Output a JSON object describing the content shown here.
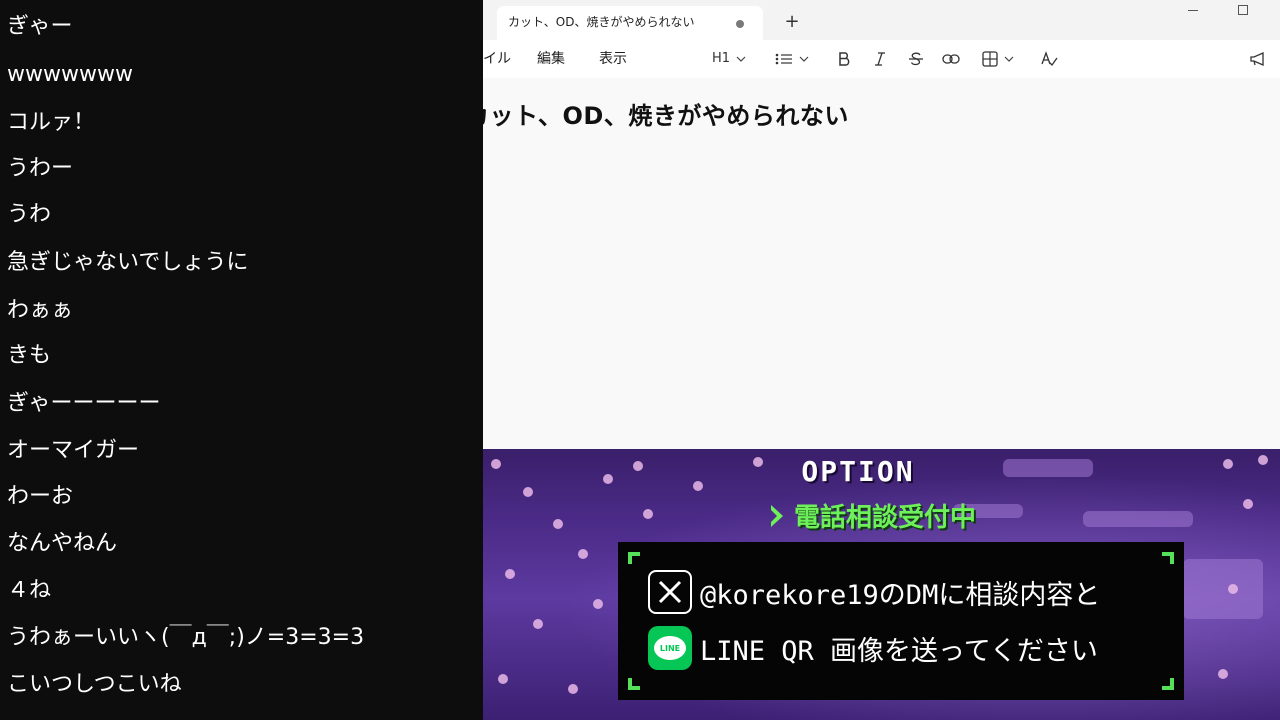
{
  "comments": [
    "ぎゃー",
    "wwwwwww",
    "コルァ！",
    "うわー",
    "うわ",
    "急ぎじゃないでしょうに",
    "わぁぁ",
    "きも",
    "ぎゃーーーーー",
    "オーマイガー",
    "わーお",
    "なんやねん",
    "４ね",
    "うわぁーいいヽ(￣д￣;)ノ=3=3=3",
    "こいつしつこいね"
  ],
  "notepad": {
    "tab_title": "カット、OD、焼きがやめられない",
    "new_tab_label": "+",
    "menu": {
      "file": "イル",
      "edit": "編集",
      "view": "表示"
    },
    "toolbar": {
      "heading_label": "H1",
      "icons": [
        "list-icon",
        "bold-icon",
        "italic-icon",
        "strikethrough-icon",
        "link-icon",
        "table-icon",
        "spellcheck-icon",
        "megaphone-icon"
      ]
    },
    "document_heading": "カット、OD、焼きがやめられない"
  },
  "banner": {
    "title": "OPTION",
    "phone_consult": "電話相談受付中",
    "x_text": "@korekore19のDMに相談内容と",
    "line_text": "LINE QR 画像を送ってください",
    "line_icon_text": "LINE",
    "colors": {
      "accent_green": "#56e05a",
      "background_purple": "#4a2a86",
      "line_green": "#06c755"
    }
  }
}
